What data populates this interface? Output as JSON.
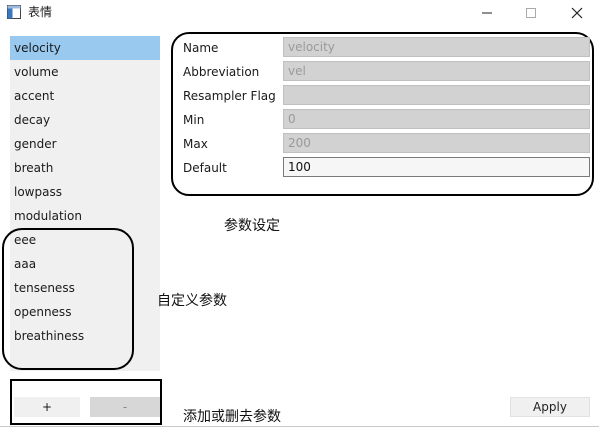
{
  "window": {
    "title": "表情",
    "icons": {
      "app": "window-app-icon",
      "minimize": "minimize-icon",
      "maximize": "maximize-icon",
      "close": "close-icon"
    }
  },
  "param_list": {
    "items": [
      {
        "label": "velocity",
        "selected": true
      },
      {
        "label": "volume"
      },
      {
        "label": "accent"
      },
      {
        "label": "decay"
      },
      {
        "label": "gender"
      },
      {
        "label": "breath"
      },
      {
        "label": "lowpass"
      },
      {
        "label": "modulation"
      },
      {
        "label": "eee"
      },
      {
        "label": "aaa"
      },
      {
        "label": "tenseness"
      },
      {
        "label": "openness"
      },
      {
        "label": "breathiness"
      }
    ],
    "add_label": "+",
    "remove_label": "-"
  },
  "form": {
    "name_label": "Name",
    "name_value": "velocity",
    "abbr_label": "Abbreviation",
    "abbr_value": "vel",
    "resampler_label": "Resampler Flag",
    "resampler_value": "",
    "min_label": "Min",
    "min_value": "0",
    "max_label": "Max",
    "max_value": "200",
    "default_label": "Default",
    "default_value": "100"
  },
  "annotations": {
    "param_settings": "参数设定",
    "custom_params": "自定义参数",
    "add_remove_params": "添加或删去参数"
  },
  "apply_label": "Apply",
  "colors": {
    "selected_row": "#99c9ef",
    "list_bg": "#f0f0f0",
    "disabled_field": "#d2d2d2"
  }
}
